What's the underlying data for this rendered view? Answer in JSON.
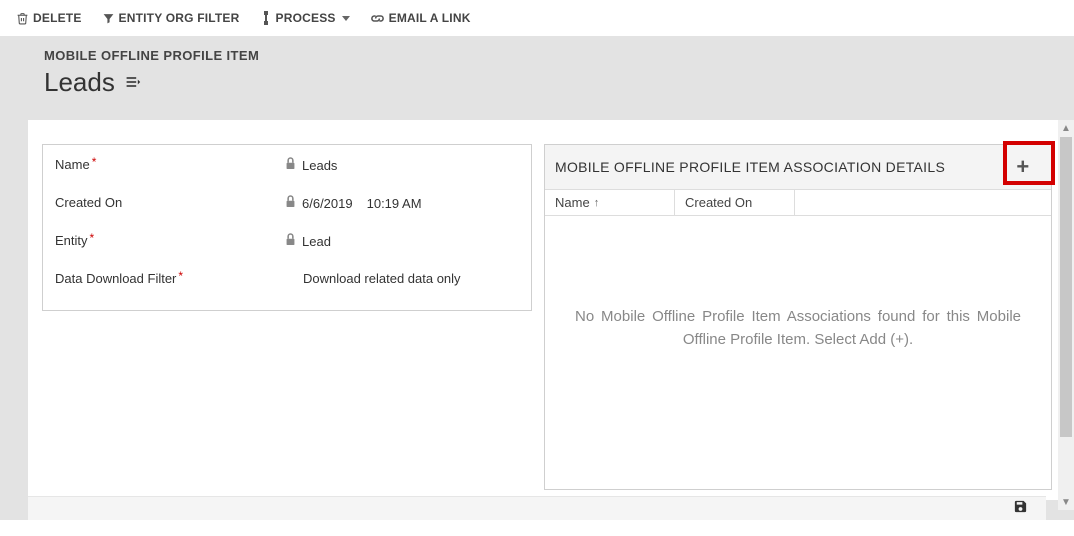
{
  "toolbar": {
    "delete_label": "DELETE",
    "entity_filter_label": "ENTITY ORG FILTER",
    "process_label": "PROCESS",
    "email_link_label": "EMAIL A LINK"
  },
  "header": {
    "record_type": "MOBILE OFFLINE PROFILE ITEM",
    "title": "Leads"
  },
  "fields": {
    "name": {
      "label": "Name",
      "value": "Leads",
      "required": true,
      "locked": true
    },
    "created_on": {
      "label": "Created On",
      "date": "6/6/2019",
      "time": "10:19 AM",
      "required": false,
      "locked": true
    },
    "entity": {
      "label": "Entity",
      "value": "Lead",
      "required": true,
      "locked": true
    },
    "data_download_filter": {
      "label": "Data Download Filter",
      "value": "Download related data only",
      "required": true,
      "locked": false
    }
  },
  "association_panel": {
    "title": "MOBILE OFFLINE PROFILE ITEM ASSOCIATION DETAILS",
    "columns": {
      "name": "Name",
      "created_on": "Created On"
    },
    "empty_message": "No Mobile Offline Profile Item Associations found for this Mobile Offline Profile Item. Select Add (+)."
  }
}
